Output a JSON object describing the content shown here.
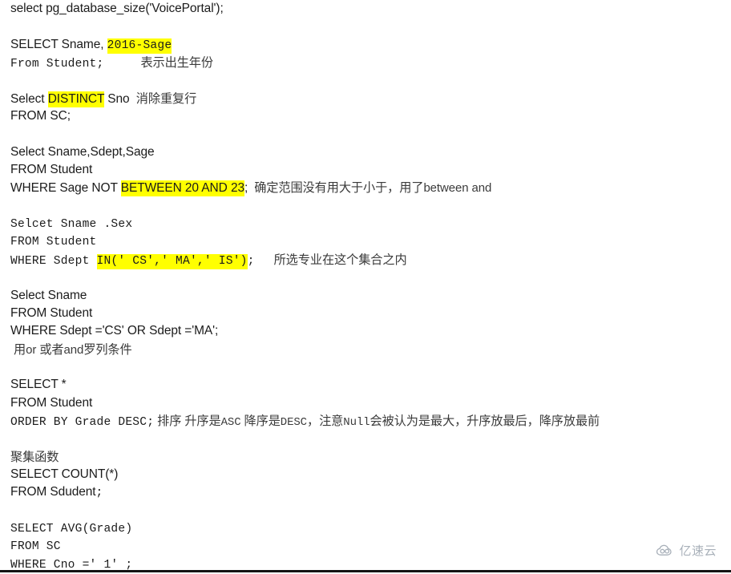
{
  "document": {
    "type": "sql-notes-screenshot",
    "highlight_color": "#ffff00",
    "text_color": "#1b1b1b",
    "annotation_color": "#3b3b3b",
    "background": "#ffffff"
  },
  "lines": {
    "l1": "select pg_database_size('VoicePortal');",
    "l3_a": "SELECT Sname, ",
    "l3_hl": "2016-Sage",
    "l4_a": "From Student;",
    "l4_cn": "表示出生年份",
    "l6_a": "Select ",
    "l6_hl": "DISTINCT",
    "l6_b": " Sno ",
    "l6_cn": "消除重复行",
    "l7": "FROM SC;",
    "l9": "Select Sname,Sdept,Sage",
    "l10": "FROM Student",
    "l11_a": "WHERE Sage NOT ",
    "l11_hl": "BETWEEN 20 AND 23",
    "l11_b": ";",
    "l11_cn": "确定范围没有用大于小于，用了",
    "l11_cn_en": "between and",
    "l13": "Selcet Sname .Sex",
    "l14": "FROM Student",
    "l15_a": "WHERE Sdept ",
    "l15_hl": "IN(' CS',' MA',' IS')",
    "l15_b": ";",
    "l15_cn": "所选专业在这个集合之内",
    "l17": "Select Sname",
    "l18": "FROM Student",
    "l19": "WHERE Sdept ='CS' OR Sdept ='MA';",
    "l20_cn1": "用",
    "l20_en1": "or ",
    "l20_cn2": "或者",
    "l20_en2": "and",
    "l20_cn3": "罗列条件",
    "l22": "SELECT *",
    "l23": "FROM Student",
    "l24_a": "ORDER BY Grade DESC;",
    "l24_cn1": "排序",
    "l24_cn2": "升序是",
    "l24_en1": "ASC",
    "l24_cn3": "降序是",
    "l24_en2": "DESC",
    "l24_cn4": "，注意",
    "l24_en3": "Null",
    "l24_cn5": "会被认为是最大，升序放最后，降序放最前",
    "l26_cn": "聚集函数",
    "l27": "SELECT COUNT(*)",
    "l28_a": "FROM Sdudent",
    "l28_b": ";",
    "l30": "SELECT AVG(Grade)",
    "l31": "FROM SC",
    "l32": "WHERE Cno =' 1' ;"
  },
  "watermark": {
    "text": "亿速云",
    "icon": "cloud-icon"
  }
}
